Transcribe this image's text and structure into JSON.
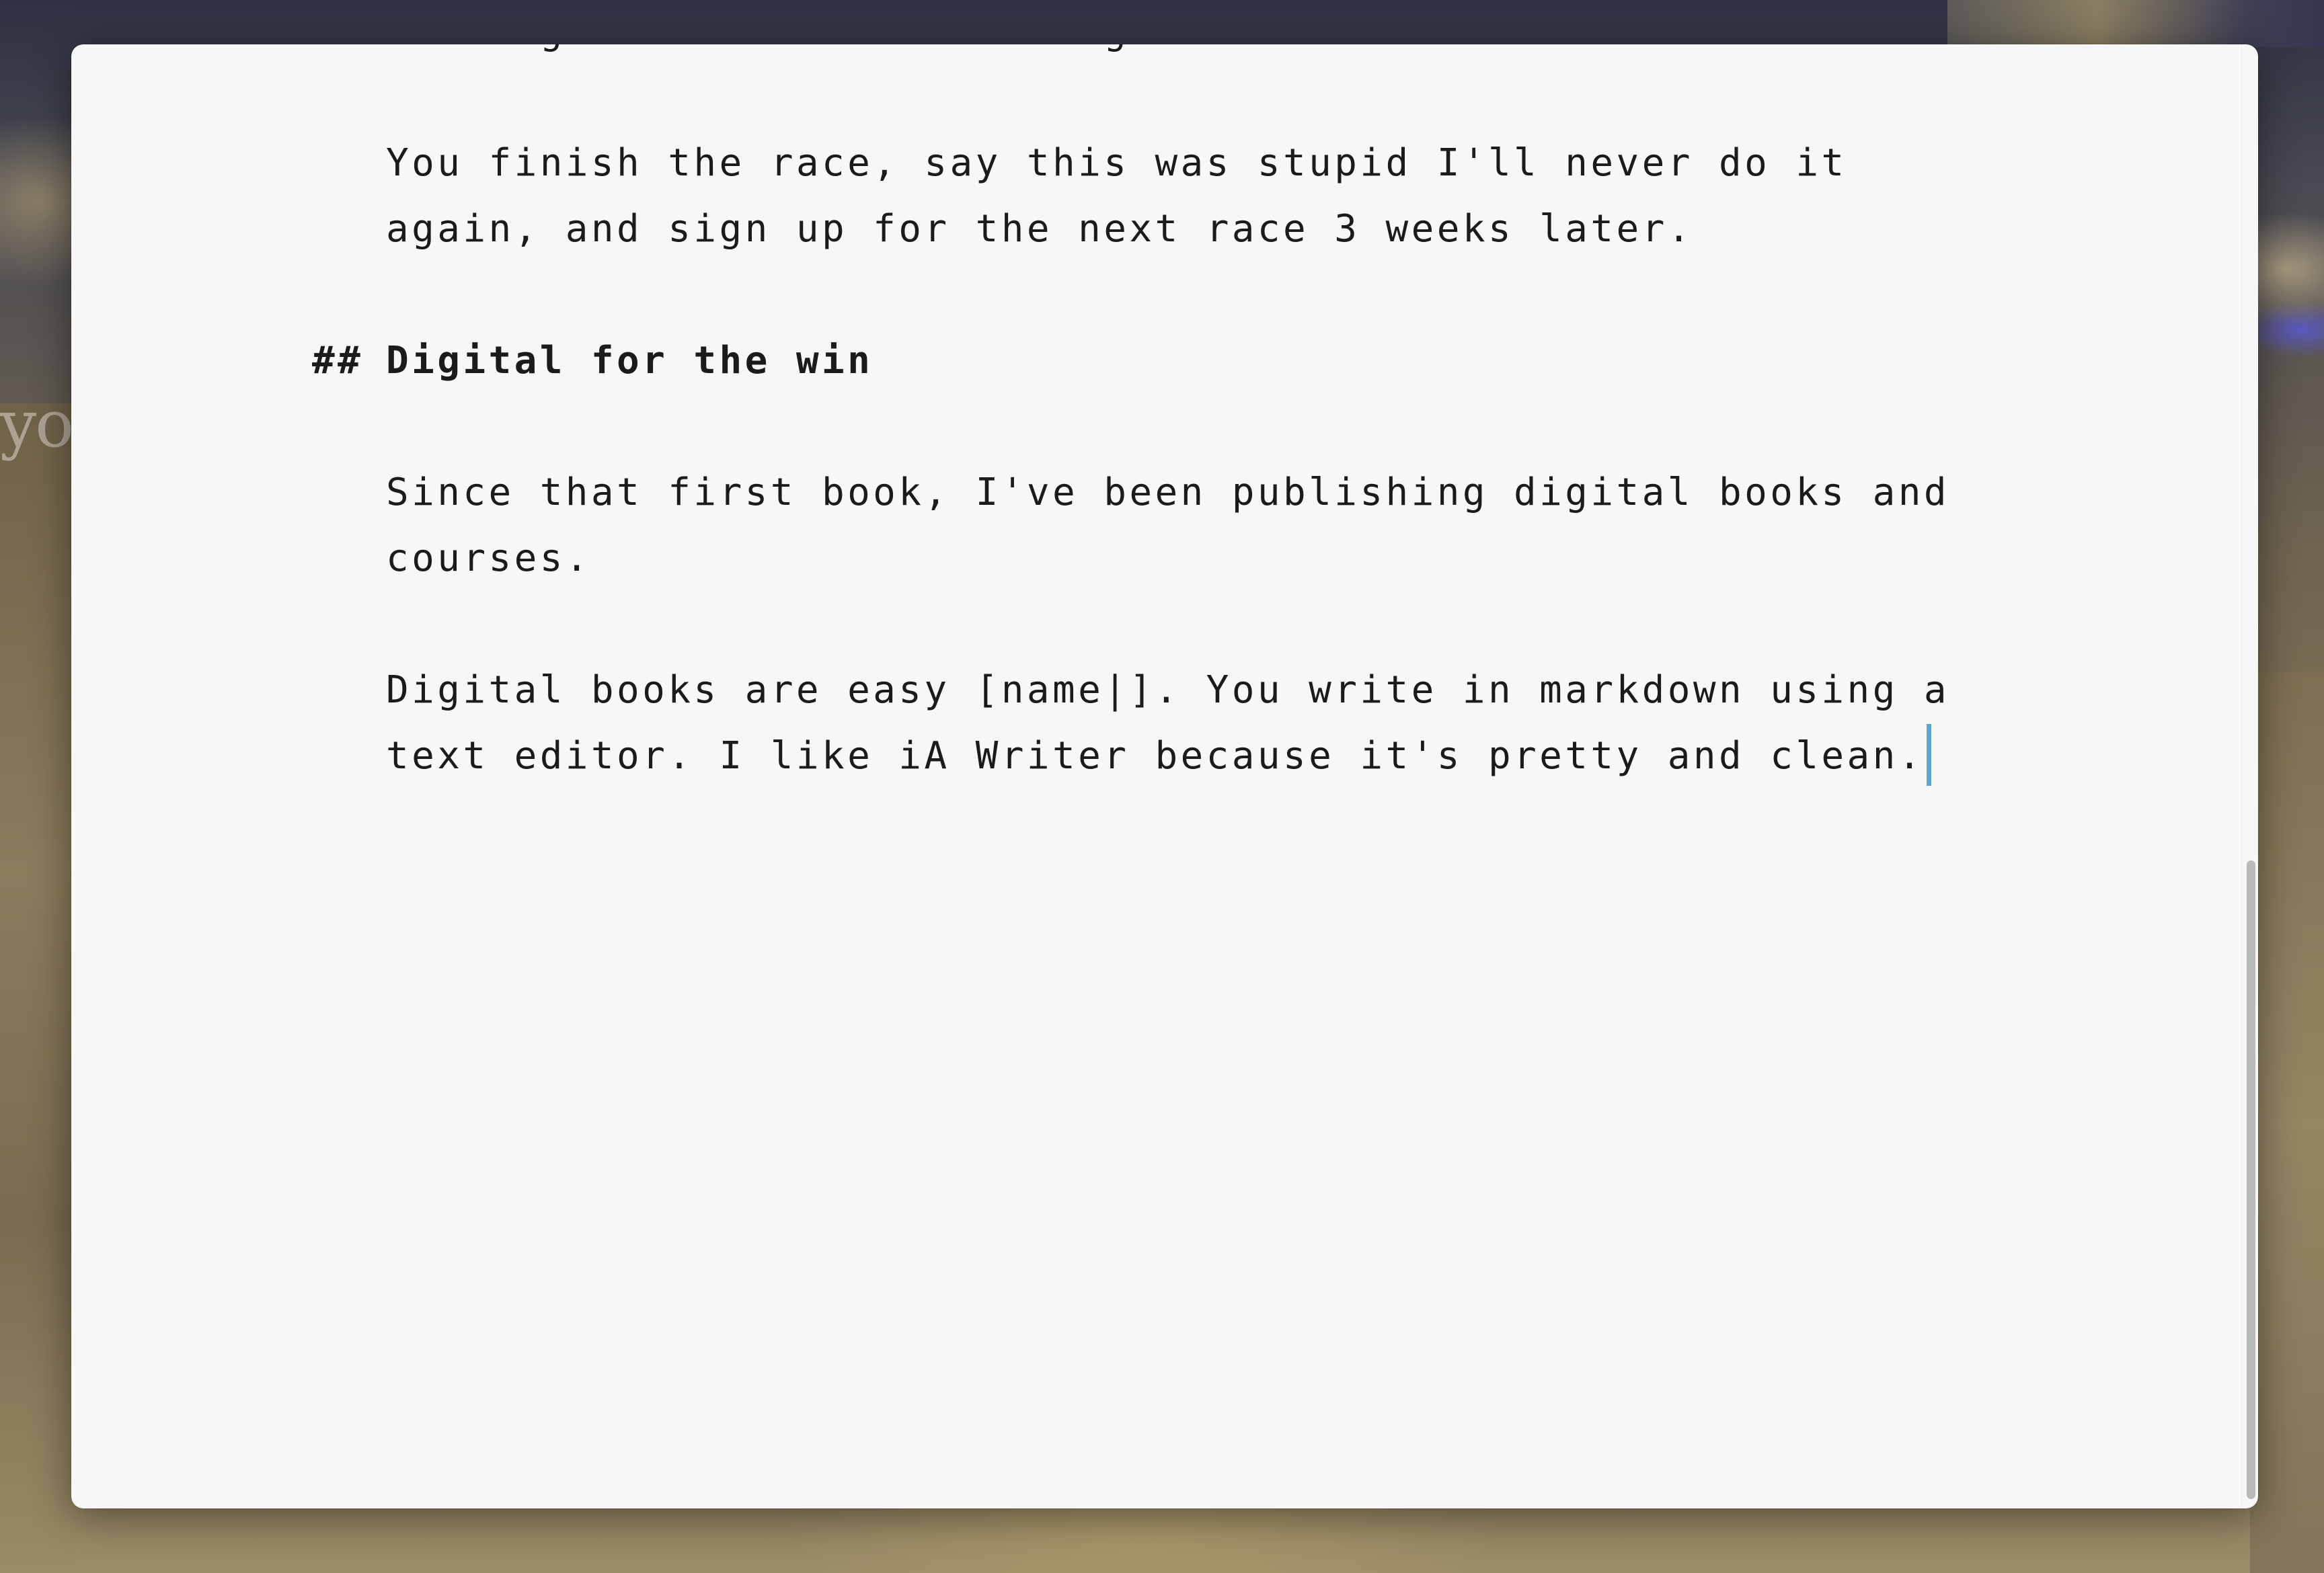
{
  "background": {
    "partial_text": "yo"
  },
  "editor": {
    "app": "iA Writer",
    "lines": {
      "l1": "Writing books is like running marathons.",
      "l2": "You finish the race, say this was stupid I'll never do it",
      "l3": "again, and sign up for the next race 3 weeks later.",
      "heading_marker": "##",
      "heading_text": "Digital for the win",
      "l5": "Since that first book, I've been publishing digital books and",
      "l6": "courses.",
      "l7": "Digital books are easy [name|]. You write in markdown using a",
      "l8": "text editor. I like iA Writer because it's pretty and clean."
    },
    "colors": {
      "background": "#f7f7f7",
      "text": "#1b1b1b",
      "caret": "#4fa9de"
    }
  }
}
